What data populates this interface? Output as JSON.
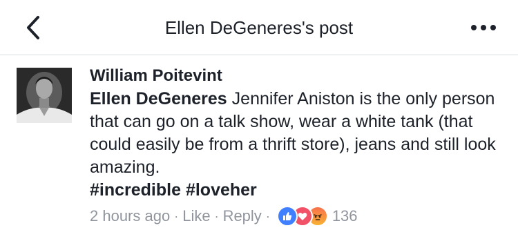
{
  "header": {
    "title": "Ellen DeGeneres's post"
  },
  "comment": {
    "author": "William Poitevint",
    "mention": "Ellen DeGeneres",
    "text": " Jennifer Aniston is the only person that can go on a talk show, wear a white tank (that could easily be from a thrift store), jeans and still look amazing.",
    "hashtags": [
      "#incredible",
      "#loveher"
    ],
    "timestamp": "2 hours ago",
    "like_label": "Like",
    "reply_label": "Reply",
    "separator": "·",
    "reaction_count": "136",
    "reaction_icons": [
      "like-icon",
      "love-icon",
      "angry-icon"
    ]
  },
  "colors": {
    "text": "#1d2129",
    "meta": "#90949c",
    "like": "#4080ff",
    "love": "#f25268",
    "angry": "#f7714c"
  }
}
